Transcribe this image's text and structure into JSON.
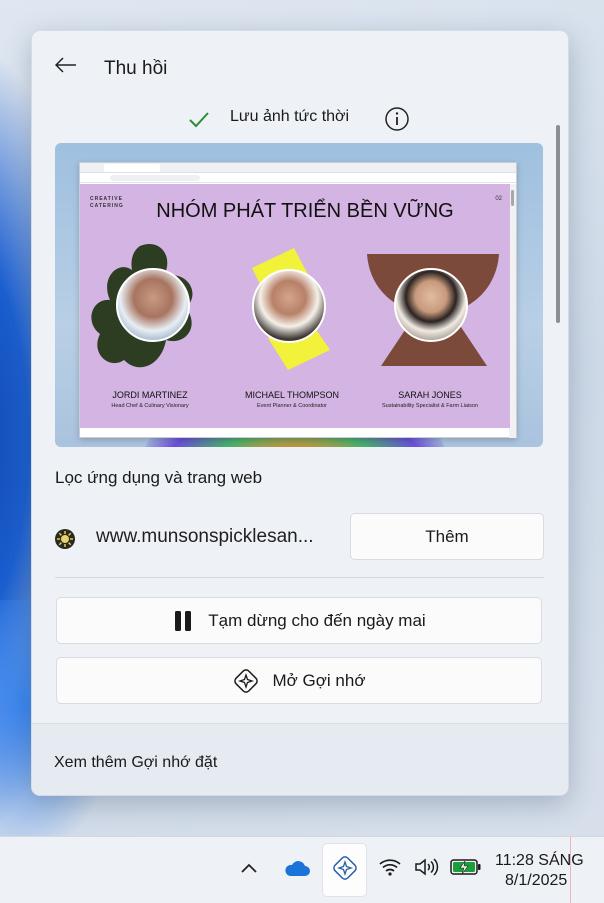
{
  "flyout": {
    "title": "Thu hồi",
    "status_text": "Lưu ảnh tức thời",
    "snapshot": {
      "brand_line1": "CREATIVE",
      "brand_line2": "CATERING",
      "page_number": "02",
      "heading": "NHÓM PHÁT TRIỂN BỀN VỮNG",
      "people": [
        {
          "name": "JORDI MARTINEZ",
          "role": "Head Chef & Culinary Visionary"
        },
        {
          "name": "MICHAEL THOMPSON",
          "role": "Event Planner & Coordinator"
        },
        {
          "name": "SARAH JONES",
          "role": "Sustainability Specialist & Farm Liaison"
        }
      ]
    },
    "filter_section_label": "Lọc ứng dụng và trang web",
    "site_url": "www.munsonspicklesan...",
    "add_button_label": "Thêm",
    "pause_button_label": "Tạm dừng cho đến ngày mai",
    "open_button_label": "Mở Gợi nhớ",
    "footer_link": "Xem thêm Gợi nhớ đặt"
  },
  "taskbar": {
    "time": "11:28 SÁNG",
    "date": "8/1/2025",
    "icons": [
      "chevron-up-icon",
      "onedrive-cloud-icon",
      "recall-icon",
      "wifi-icon",
      "volume-icon",
      "battery-charging-icon"
    ]
  },
  "colors": {
    "accent_check": "#2e8b3a",
    "slide_background": "#d3b4e3",
    "battery_green": "#1c9e3a"
  }
}
